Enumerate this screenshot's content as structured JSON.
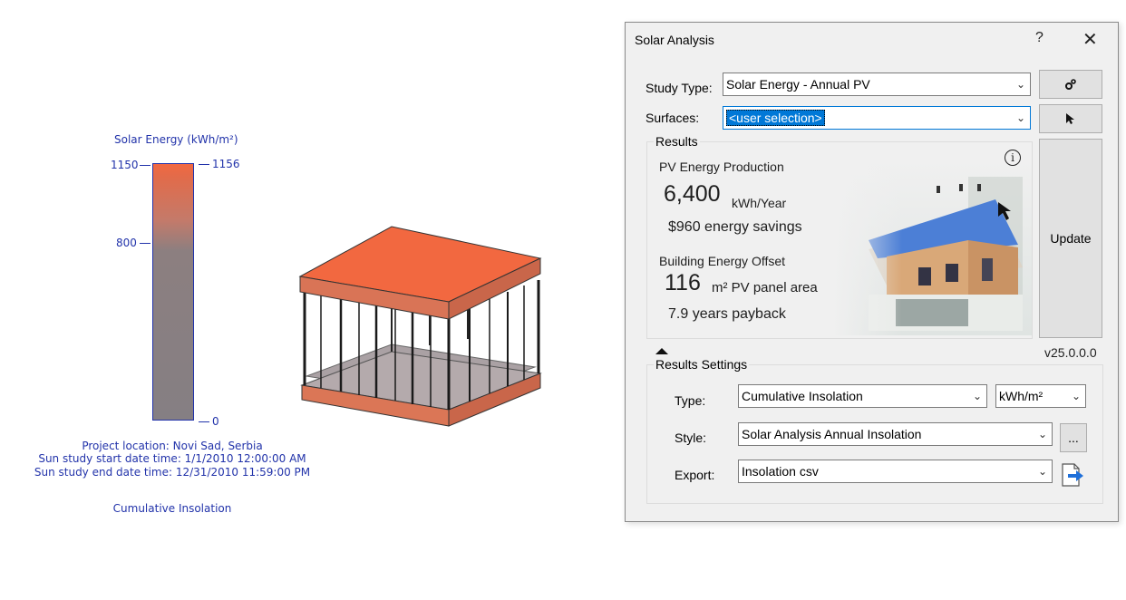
{
  "legend": {
    "title": "Solar Energy (kWh/m²)",
    "left_max": "1150",
    "left_mid": "800",
    "right_max": "1156",
    "right_min": "0",
    "project_location": "Project location: Novi Sad, Serbia",
    "start": "Sun study start date time: 1/1/2010 12:00:00 AM",
    "end": "Sun study end date time: 12/31/2010 11:59:00 PM",
    "type": "Cumulative Insolation"
  },
  "dialog": {
    "title": "Solar Analysis",
    "help": "?",
    "close": "✕",
    "study_type_label": "Study Type:",
    "study_type_value": "Solar Energy - Annual PV",
    "surfaces_label": "Surfaces:",
    "surfaces_value": "<user selection>",
    "results": {
      "title": "Results",
      "pv_heading": "PV Energy Production",
      "pv_value": "6,400",
      "pv_unit": "kWh/Year",
      "savings": "$960 energy savings",
      "offset_heading": "Building Energy Offset",
      "offset_value": "116",
      "offset_unit": "m² PV panel area",
      "payback": "7.9 years payback",
      "info": "i"
    },
    "update_label": "Update",
    "version": "v25.0.0.0",
    "settings": {
      "title": "Results Settings",
      "type_label": "Type:",
      "type_value": "Cumulative Insolation",
      "unit_value": "kWh/m²",
      "style_label": "Style:",
      "style_value": "Solar Analysis Annual Insolation",
      "style_more": "...",
      "export_label": "Export:",
      "export_value": "Insolation csv"
    }
  },
  "colors": {
    "accent": "#0078d7",
    "roof": "#f26840",
    "legend_text": "#2233aa"
  }
}
